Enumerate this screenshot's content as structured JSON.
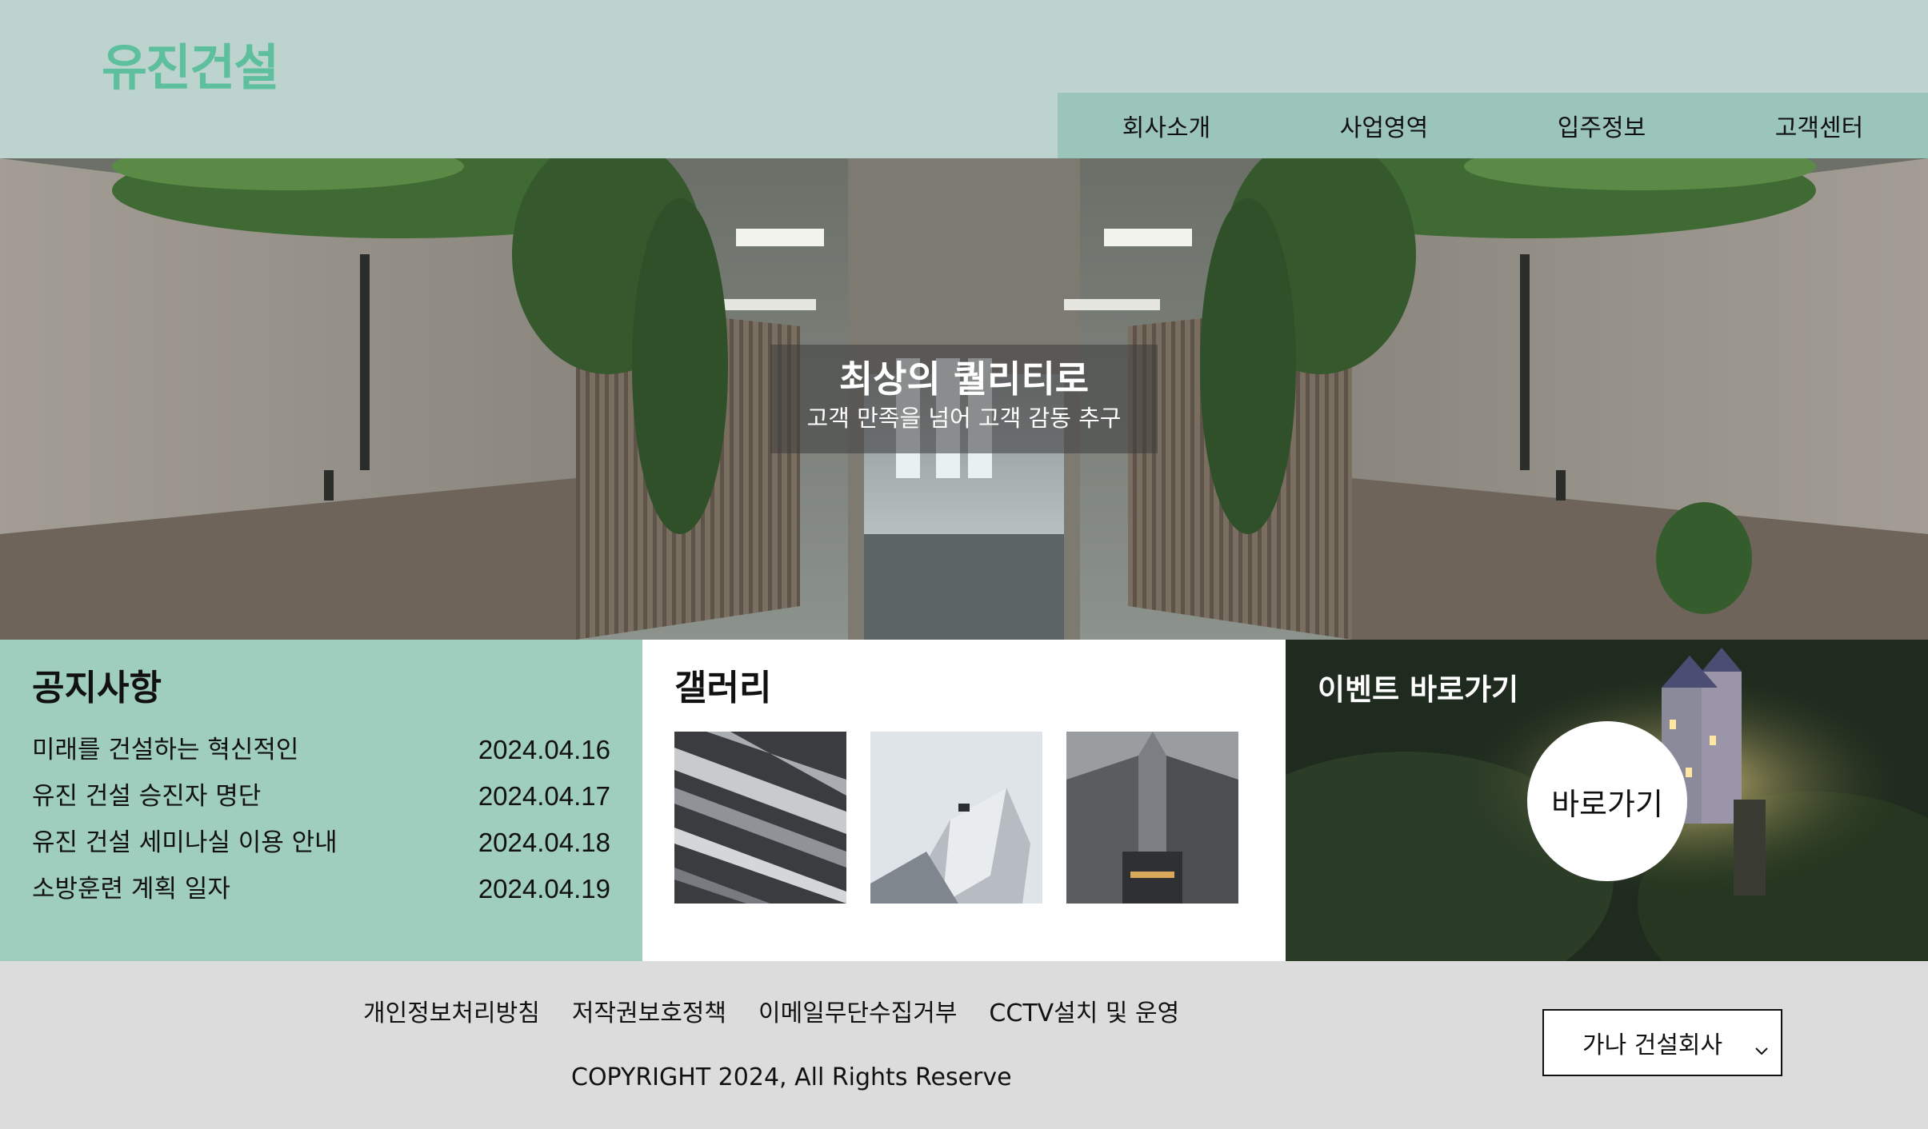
{
  "header": {
    "logo": "유진건설",
    "nav": [
      "회사소개",
      "사업영역",
      "입주정보",
      "고객센터"
    ]
  },
  "hero": {
    "title": "최상의 퀄리티로",
    "subtitle": "고객 만족을 넘어 고객 감동 추구"
  },
  "notice": {
    "title": "공지사항",
    "items": [
      {
        "text": "미래를 건설하는 혁신적인",
        "date": "2024.04.16"
      },
      {
        "text": "유진 건설 승진자 명단",
        "date": "2024.04.17"
      },
      {
        "text": "유진 건설 세미나실 이용 안내",
        "date": "2024.04.18"
      },
      {
        "text": "소방훈련 계획 일자",
        "date": "2024.04.19"
      }
    ]
  },
  "gallery": {
    "title": "갤러리"
  },
  "event": {
    "title": "이벤트 바로가기",
    "button_label": "바로가기"
  },
  "footer": {
    "links": [
      "개인정보처리방침",
      "저작권보호정책",
      "이메일무단수집거부",
      "CCTV설치 및 운영"
    ],
    "copyright": "COPYRIGHT 2024, All Rights Reserve",
    "family_site": {
      "selected": "가나 건설회사",
      "icon": "chevron-down-icon"
    }
  },
  "colors": {
    "header_bg": "#bcd3ce",
    "nav_bg": "#9bc4ba",
    "logo": "#5dbf9d",
    "notice_bg": "#9fcdbe",
    "footer_bg": "#dcdcdc"
  }
}
